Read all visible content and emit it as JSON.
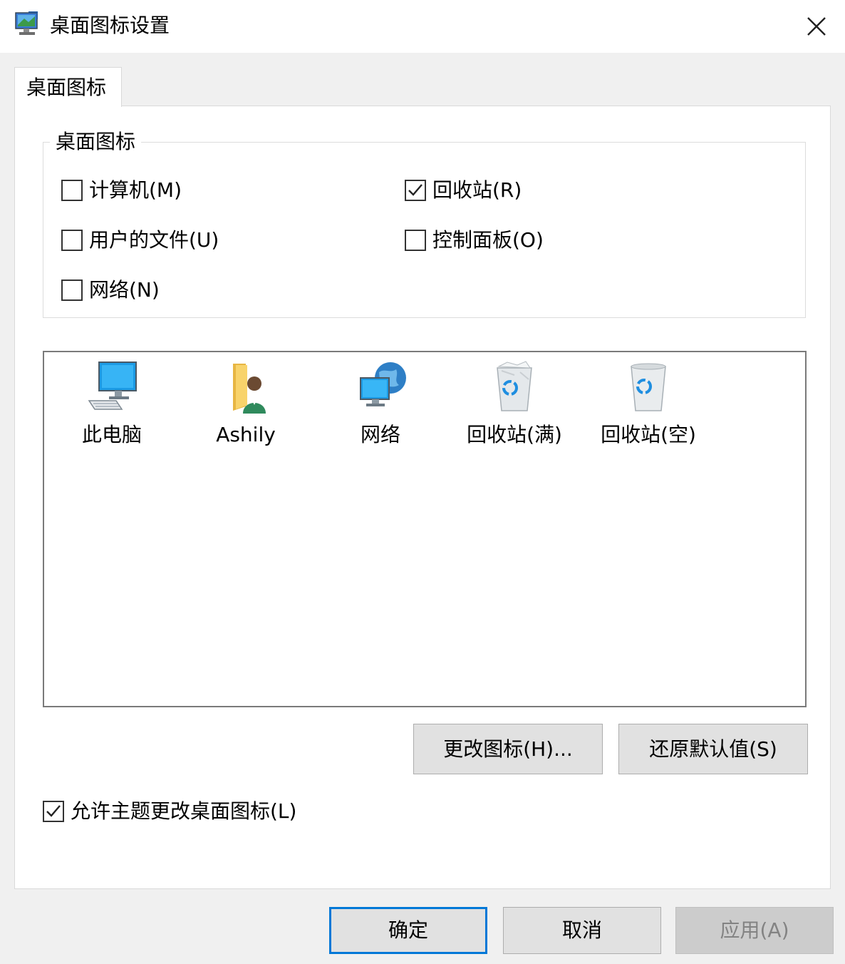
{
  "window": {
    "title": "桌面图标设置",
    "icons": {
      "app": "monitor-settings-icon",
      "close": "close-icon"
    }
  },
  "tabs": [
    {
      "label": "桌面图标",
      "selected": true
    }
  ],
  "group": {
    "legend": "桌面图标",
    "checkboxes": [
      {
        "label": "计算机(M)",
        "checked": false
      },
      {
        "label": "回收站(R)",
        "checked": true
      },
      {
        "label": "用户的文件(U)",
        "checked": false
      },
      {
        "label": "控制面板(O)",
        "checked": false
      },
      {
        "label": "网络(N)",
        "checked": false
      }
    ]
  },
  "preview": {
    "items": [
      {
        "label": "此电脑",
        "icon": "computer-icon"
      },
      {
        "label": "Ashily",
        "icon": "user-folder-icon"
      },
      {
        "label": "网络",
        "icon": "network-icon"
      },
      {
        "label": "回收站(满)",
        "icon": "recycle-bin-full-icon"
      },
      {
        "label": "回收站(空)",
        "icon": "recycle-bin-empty-icon"
      }
    ]
  },
  "buttons": {
    "change_icon": "更改图标(H)...",
    "restore_default": "还原默认值(S)"
  },
  "theme_checkbox": {
    "label": "允许主题更改桌面图标(L)",
    "checked": true
  },
  "footer": {
    "ok": "确定",
    "cancel": "取消",
    "apply": "应用(A)",
    "apply_enabled": false
  },
  "colors": {
    "accent": "#0078d7",
    "panel": "#ffffff",
    "dialog_bg": "#f0f0f0"
  }
}
